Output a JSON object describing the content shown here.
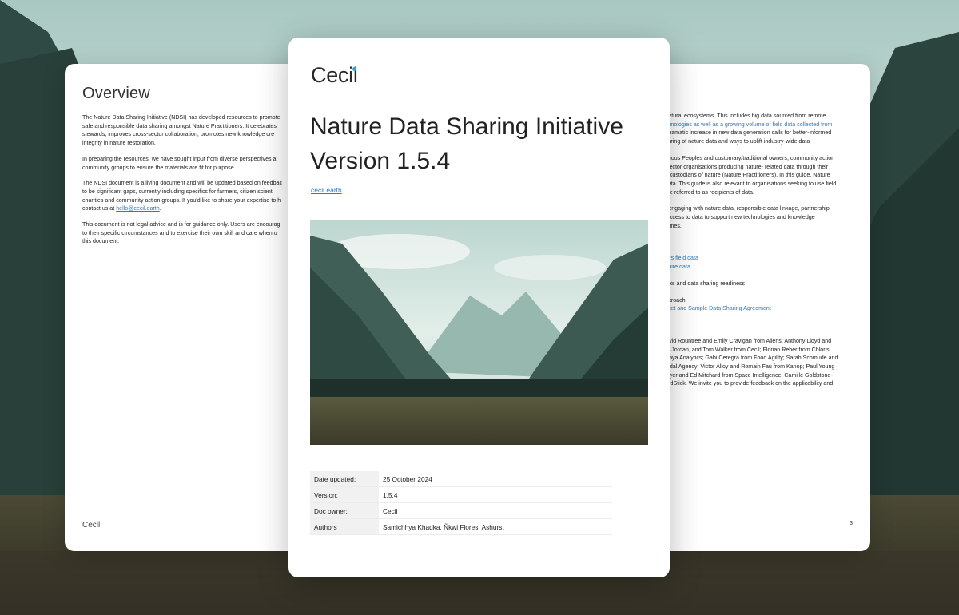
{
  "left_page": {
    "title": "Overview",
    "paragraphs": [
      [
        "The Nature Data Sharing Initiative (NDSI) has developed resources to promote",
        "safe and responsible data sharing amongst Nature Practitioners. It celebrates",
        "stewards, improves cross-sector collaboration, promotes new knowledge cre",
        "integrity in nature restoration."
      ],
      [
        "In preparing the resources, we have sought input from diverse perspectives a",
        "community groups to ensure the materials are fit for purpose."
      ],
      [
        "The NDSI document is a living document and will be updated based on feedbac",
        "to be significant gaps, currently including specifics for farmers, citizen scienti",
        "charities and community action groups. If you'd like to share your expertise to h",
        "contact us at "
      ],
      [
        "This document is not legal advice and is for guidance only. Users are encourag",
        "to their specific circumstances and to exercise their own skill and care when u",
        "this document."
      ]
    ],
    "email": "hello@cecil.earth",
    "footer": "Cecil"
  },
  "right_page": {
    "lines": [
      "r natural ecosystems. This includes big data sourced from remote",
      "echnologies as well as a growing volume of field data collected from",
      "e dramatic increase in new data generation calls for better-informed",
      "sharing of nature data and ways to uplift industry-wide data",
      "",
      "genous Peoples and customary/traditional owners, community action",
      "e sector organisations producing nature- related data through their",
      "ng custodians of nature (Nature Practitioners). In this guide, Nature",
      "f data. This guide is also relevant to organisations seeking to use field",
      "n be referred to as recipients of data.",
      "",
      "or engaging with nature data, responsible data linkage, partnership",
      "d access to data to support new technologies and knowledge",
      "tcomes.",
      "",
      "",
      "",
      "ner's field data",
      " nature data",
      "",
      "ssets and data sharing readiness",
      "",
      "approach",
      "sheet and Sample Data Sharing Agreement",
      "",
      "",
      "",
      "David Rountree and Emily Cravigan from Allens; Anthony Lloyd and",
      "nor Jordan, and Tom Walker from Cecil; Florian Reber from Chloris",
      "Dunya Analytics; Gabi Ceregra from Food Agility; Sarah Schmude and",
      "ertidal Agency; Victor Alloy and Romain Fau from Kanop; Paul Young",
      "Moyer and Ed Mitchard from Space Intelligence; Camille Goldstone-",
      "YardStick. We invite you to provide feedback on the applicability and"
    ],
    "page_number": "3"
  },
  "front_page": {
    "logo": "Cecil",
    "title_line1": "Nature Data Sharing Initiative",
    "title_line2": "Version 1.5.4",
    "link": "cecil.earth",
    "meta": [
      {
        "label": "Date updated:",
        "value": "25 October 2024"
      },
      {
        "label": "Version:",
        "value": "1.5.4"
      },
      {
        "label": "Doc owner:",
        "value": "Cecil"
      },
      {
        "label": "Authors",
        "value": "Samichhya Khadka, Ñkwi Flores, Ashurst"
      }
    ]
  },
  "colors": {
    "link": "#2a7bc4",
    "logo_dot": "#37a6d6"
  }
}
